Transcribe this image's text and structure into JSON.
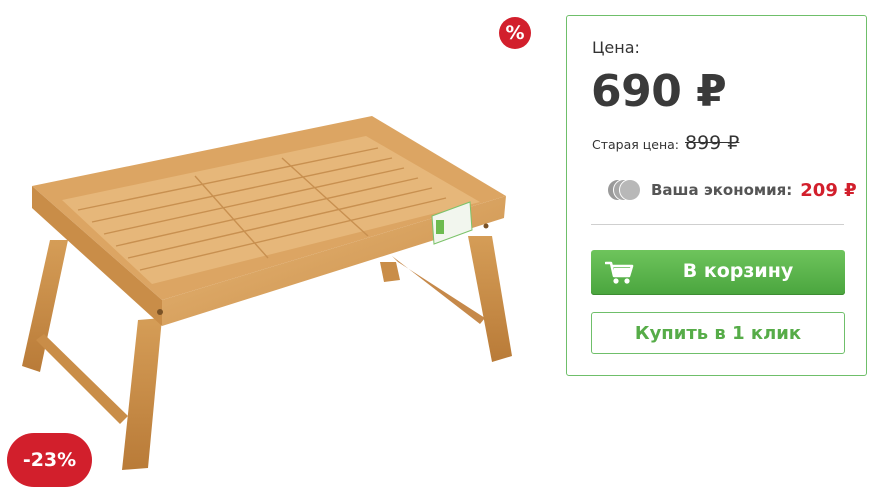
{
  "badges": {
    "percent_symbol": "%",
    "discount": "-23%"
  },
  "product": {
    "image_description_icon": "bamboo-bed-tray-image"
  },
  "price": {
    "label": "Цена:",
    "current": "690 ₽",
    "old_label": "Старая цена:",
    "old_value": "899 ₽",
    "saving_label": "Ваша экономия:",
    "saving_value": "209 ₽"
  },
  "buttons": {
    "cart": "В корзину",
    "one_click": "Купить в 1 клик"
  },
  "colors": {
    "accent_green": "#56ac48",
    "sale_red": "#d21f2c",
    "panel_border": "#6fbf6a"
  }
}
